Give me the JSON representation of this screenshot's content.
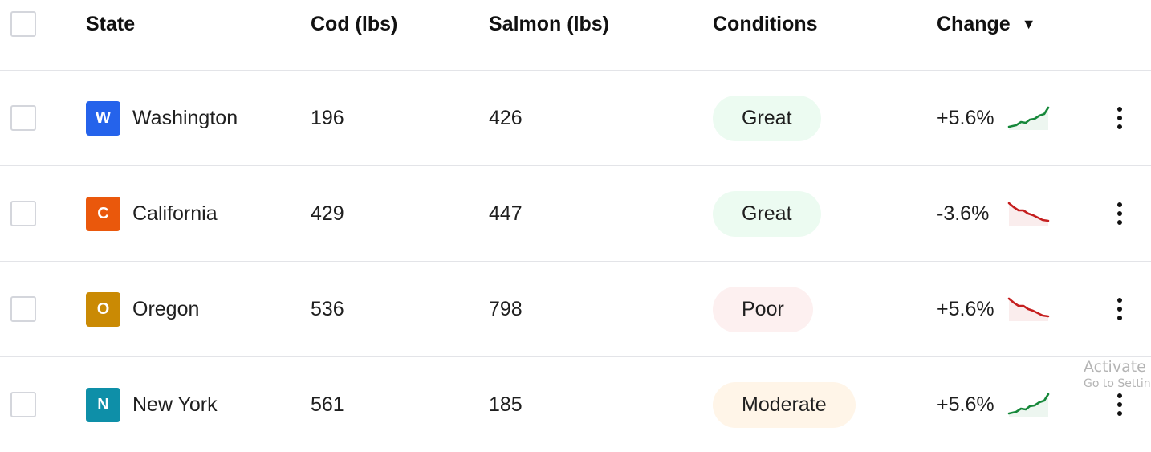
{
  "header": {
    "state": "State",
    "cod": "Cod (lbs)",
    "salmon": "Salmon (lbs)",
    "conditions": "Conditions",
    "change": "Change",
    "sort_icon": "caret-down-icon"
  },
  "rows": [
    {
      "initial": "W",
      "avatar_color": "#2563eb",
      "state": "Washington",
      "cod": "196",
      "salmon": "426",
      "condition": "Great",
      "condition_bg": "#ecfbf1",
      "change": "+5.6%",
      "trend": "up",
      "trend_color": "#16883a"
    },
    {
      "initial": "C",
      "avatar_color": "#ea580c",
      "state": "California",
      "cod": "429",
      "salmon": "447",
      "condition": "Great",
      "condition_bg": "#ecfbf1",
      "change": "-3.6%",
      "trend": "down",
      "trend_color": "#c51f1f"
    },
    {
      "initial": "O",
      "avatar_color": "#ca8a04",
      "state": "Oregon",
      "cod": "536",
      "salmon": "798",
      "condition": "Poor",
      "condition_bg": "#fdf0f0",
      "change": "+5.6%",
      "trend": "down",
      "trend_color": "#c51f1f"
    },
    {
      "initial": "N",
      "avatar_color": "#0e8fa8",
      "state": "New York",
      "cod": "561",
      "salmon": "185",
      "condition": "Moderate",
      "condition_bg": "#fff5e8",
      "change": "+5.6%",
      "trend": "up",
      "trend_color": "#16883a"
    }
  ],
  "watermark": {
    "line1": "Activate W",
    "line2": "Go to Setting"
  }
}
